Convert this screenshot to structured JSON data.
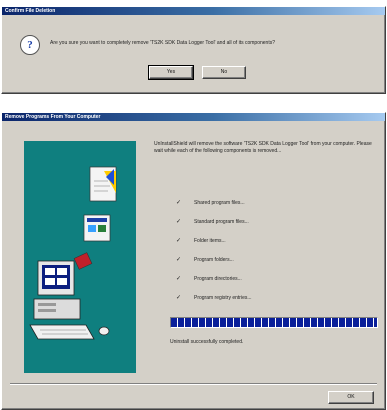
{
  "confirm_dialog": {
    "title": "Confirm File Deletion",
    "icon": "question-icon",
    "message": "Are you sure you want to completely remove 'TS2K SDK Data Logger Tool' and all of its components?",
    "yes_label": "Yes",
    "no_label": "No"
  },
  "remove_dialog": {
    "title": "Remove Programs From Your Computer",
    "description": "UnInstallShield will remove the software 'TS2K SDK Data Logger Tool' from your computer. Please wait while each of the following components is removed...",
    "steps": [
      {
        "label": "Shared program files..."
      },
      {
        "label": "Standard program files..."
      },
      {
        "label": "Folder items..."
      },
      {
        "label": "Program folders..."
      },
      {
        "label": "Program directories..."
      },
      {
        "label": "Program registry entries..."
      }
    ],
    "progress_percent": 100,
    "status": "Uninstall successfully completed.",
    "ok_label": "OK"
  }
}
